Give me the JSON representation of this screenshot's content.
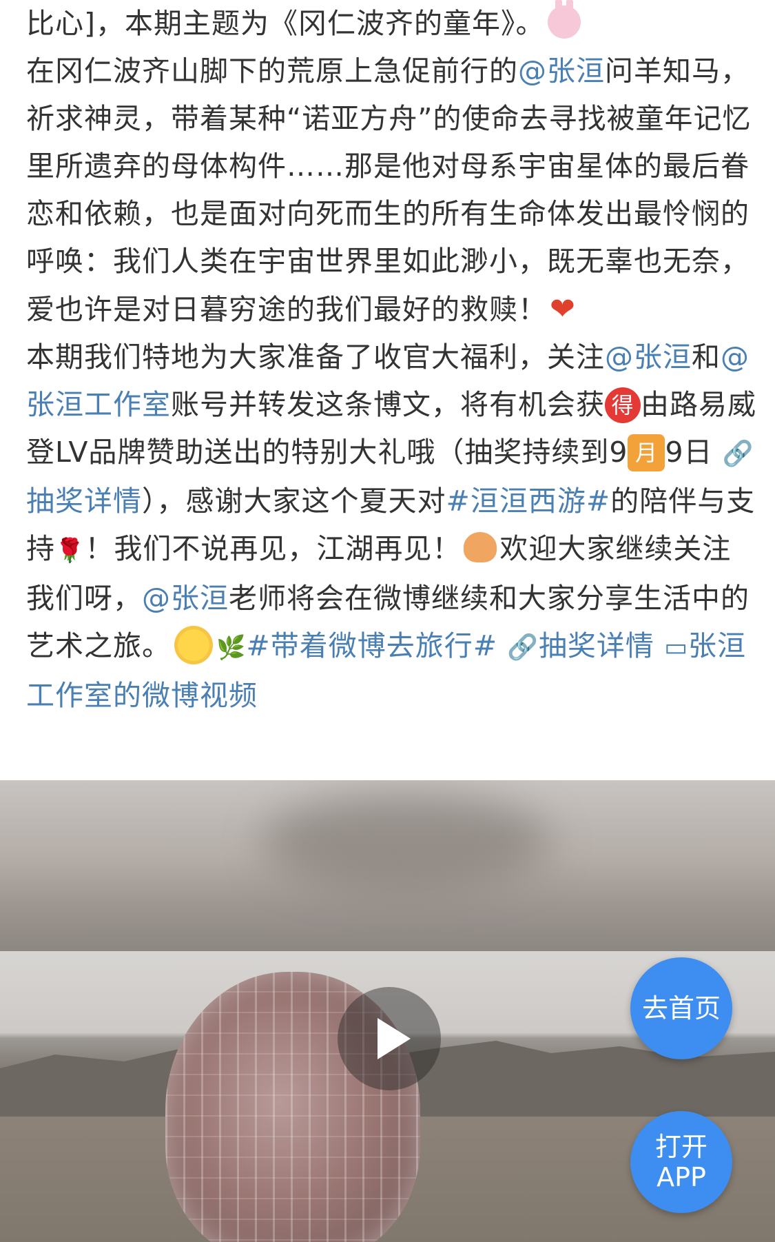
{
  "post": {
    "t1": "比心]，本期主题为《冈仁波齐的童年》。",
    "t2": "在冈仁波齐山脚下的荒原上急促前行的",
    "mention1": "@张洹",
    "t3": "问羊知马，祈求神灵，带着某种“诺亚方舟”的使命去寻找被童年记忆里所遗弃的母体构件……那是他对母系宇宙星体的最后眷恋和依赖，也是面对向死而生的所有生命体发出最怜悯的呼唤：我们人类在宇宙世界里如此渺小，既无辜也无奈，爱也许是对日暮穷途的我们最好的救赎！",
    "t4": "本期我们特地为大家准备了收官大福利，关注",
    "mention2": "@张洹",
    "t5": "和",
    "mention3": "@张洹工作室",
    "t6": "账号并转发这条博文，将有机会获",
    "badge_de": "得",
    "t7": "由路易威登LV品牌赞助送出的特别大礼哦（抽奖持续到9",
    "badge_month": "月",
    "t8": "9日",
    "lottery_link1": "抽奖详情",
    "t9": "），感谢大家这个夏天对",
    "hashtag1": "#洹洹西游#",
    "t10": "的陪伴与支持",
    "t11": "！我们不说再见，江湖再见！",
    "t12": "欢迎大家继续关注我们呀，",
    "mention4": "@张洹",
    "t13": "老师将会在微博继续和大家分享生活中的艺术之旅。",
    "hashtag2": "#带着微博去旅行#",
    "lottery_link2": "抽奖详情",
    "video_link": "张洹工作室的微博视频"
  },
  "buttons": {
    "home": "去首页",
    "open_line1": "打开",
    "open_line2": "APP"
  },
  "icons": [
    "bunny-emoji-icon",
    "heart-emoji-icon",
    "rose-emoji-icon",
    "hands-emoji-icon",
    "sun-emoji-icon",
    "leaf-emoji-icon",
    "link-icon",
    "video-icon",
    "play-icon"
  ],
  "colors": {
    "link": "#4a7fb4",
    "button": "#3d8ef0",
    "heart": "#e0412c"
  }
}
